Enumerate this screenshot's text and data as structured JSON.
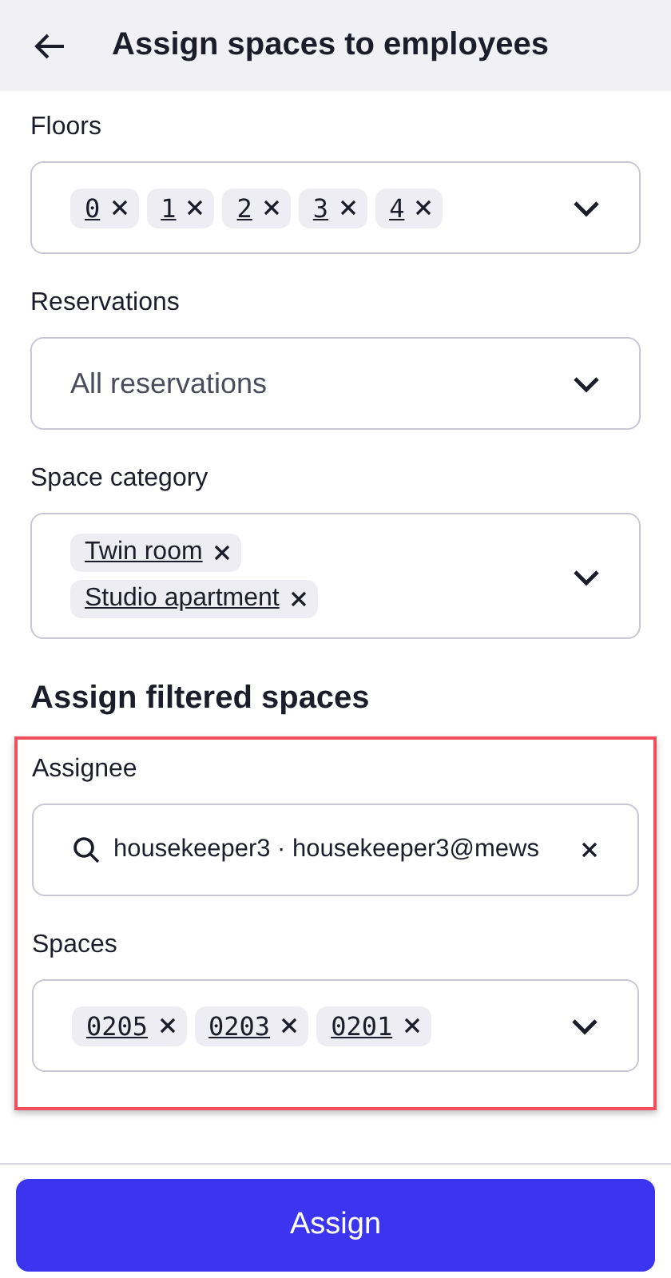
{
  "header": {
    "title": "Assign spaces to employees"
  },
  "filters": [
    {
      "label": "Floors",
      "kind": "chips",
      "monospace": true,
      "chips": [
        "0",
        "1",
        "2",
        "3",
        "4"
      ]
    },
    {
      "label": "Reservations",
      "kind": "select",
      "value": "All reservations"
    },
    {
      "label": "Space category",
      "kind": "chips",
      "monospace": false,
      "chips": [
        "Twin room",
        "Studio apartment"
      ]
    }
  ],
  "assign": {
    "heading": "Assign filtered spaces",
    "highlighted": true,
    "fields": [
      {
        "label": "Assignee",
        "kind": "search",
        "value": "housekeeper3 · housekeeper3@mews"
      },
      {
        "label": "Spaces",
        "kind": "chips",
        "monospace": true,
        "chips": [
          "0205",
          "0203",
          "0201"
        ]
      }
    ]
  },
  "button": "Assign"
}
